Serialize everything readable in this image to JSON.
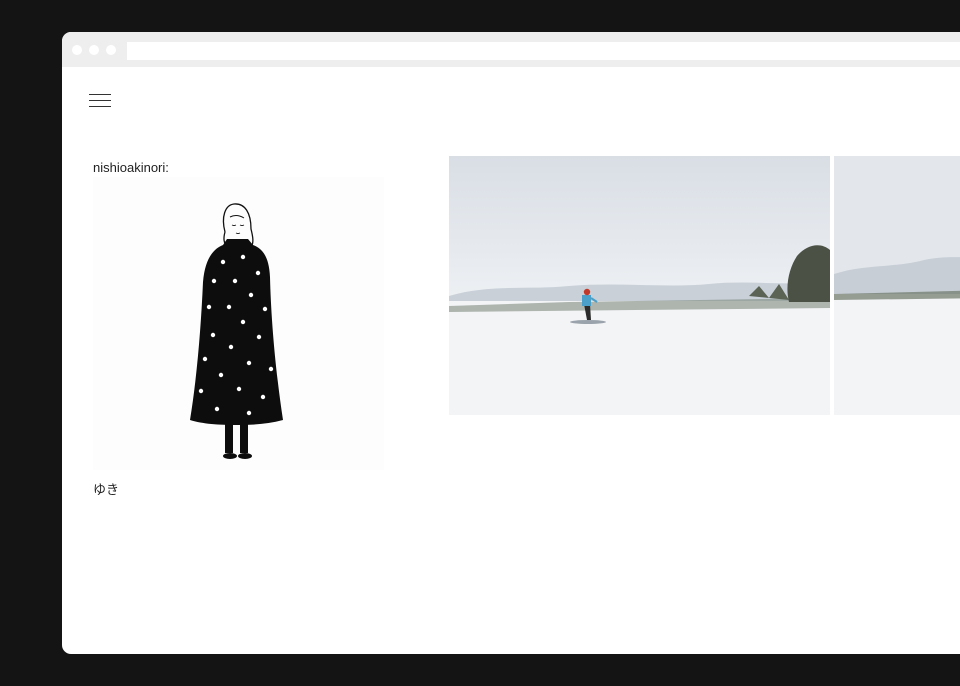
{
  "browser": {
    "traffic_lights": [
      "close",
      "minimize",
      "maximize"
    ]
  },
  "nav": {
    "menu_icon": "hamburger-menu-icon"
  },
  "post": {
    "author": "nishioakinori:",
    "caption": "ゆき",
    "illustration": "girl-in-polka-dot-coat",
    "photos": [
      "skier-on-snowfield",
      "snowy-field-with-trees"
    ]
  }
}
